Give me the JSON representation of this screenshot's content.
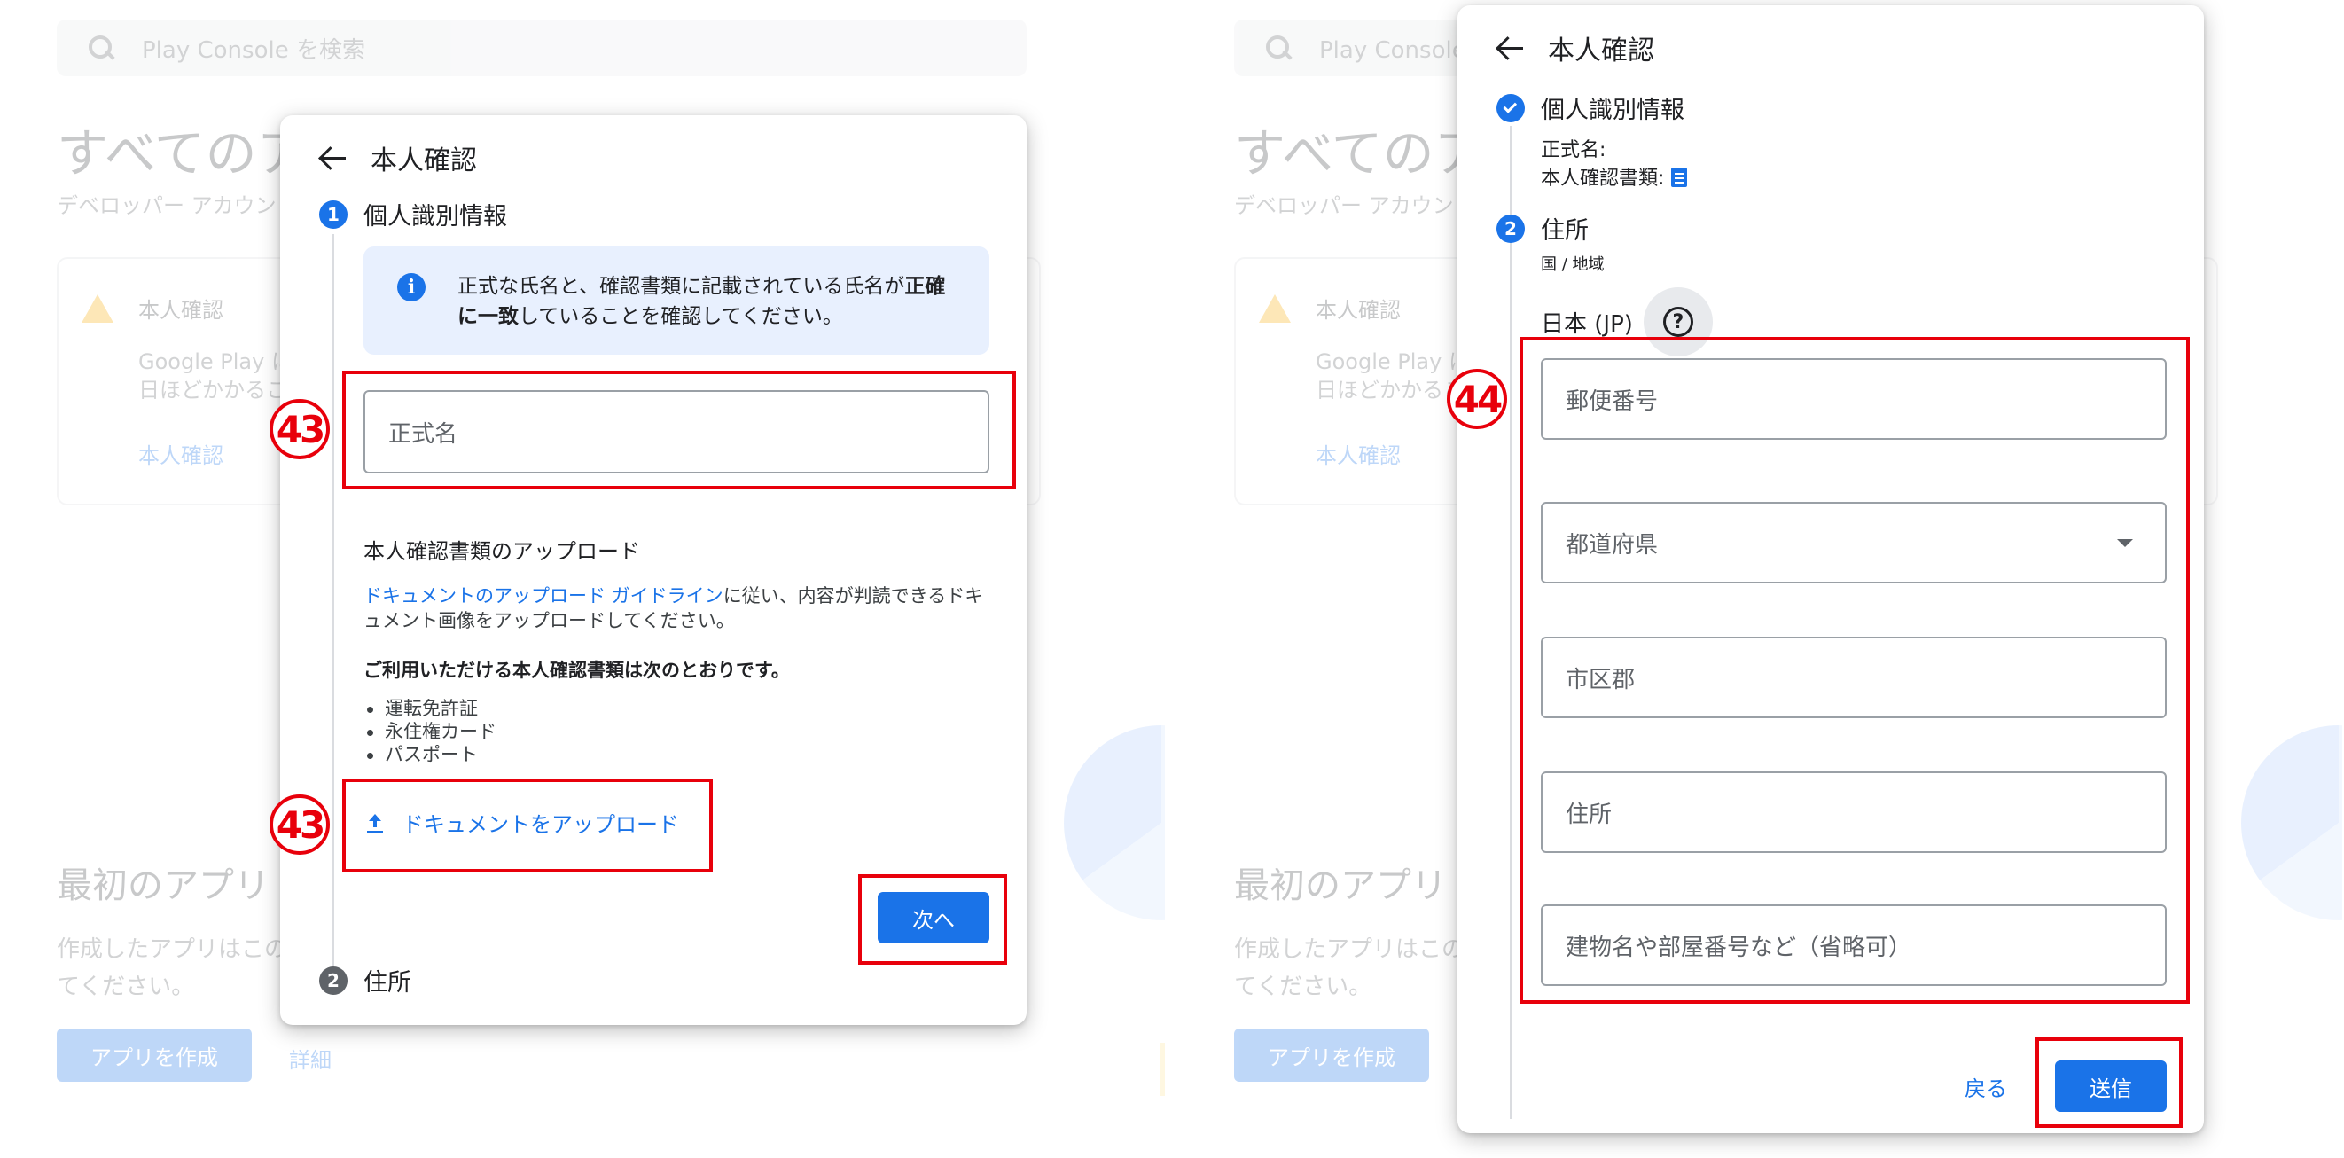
{
  "background": {
    "search_placeholder": "Play Console を検索",
    "heading_all_apps": "すべてのア",
    "heading_all_apps_right": "すべてのア",
    "developer_account_text": "デベロッパー アカウント",
    "warning_title": "本人確認",
    "warning_body_line1": "Google Play に",
    "warning_body_line2": "日ほどかかるこ",
    "warning_link": "本人確認",
    "first_app_heading": "最初のアプリ",
    "first_app_body_line1": "作成したアプリはこの",
    "first_app_body_line2": "てください。",
    "create_app_button": "アプリを作成",
    "details_link": "詳細"
  },
  "left_dialog": {
    "title": "本人確認",
    "step1_number": "1",
    "step1_label": "個人識別情報",
    "info_text_before": "正式な氏名と、確認書類に記載されている氏名が",
    "info_text_bold": "正確に一致",
    "info_text_after": "していることを確認してください。",
    "legal_name_placeholder": "正式名",
    "upload_section_title": "本人確認書類のアップロード",
    "guideline_link": "ドキュメントのアップロード ガイドライン",
    "guideline_text": "に従い、内容が判読できるドキュメント画像をアップロードしてください。",
    "accepted_docs_title": "ご利用いただける本人確認書類は次のとおりです。",
    "accepted_docs": [
      "運転免許証",
      "永住権カード",
      "パスポート"
    ],
    "upload_button": "ドキュメントをアップロード",
    "next_button": "次へ",
    "step2_number": "2",
    "step2_label": "住所",
    "marker_1": "43",
    "marker_2": "43"
  },
  "right_dialog": {
    "title": "本人確認",
    "step1_label": "個人識別情報",
    "legal_name_label": "正式名:",
    "id_doc_label": "本人確認書類:",
    "step2_number": "2",
    "step2_label": "住所",
    "country_label": "国 / 地域",
    "country_value": "日本 (JP)",
    "fields": {
      "postal_code": "郵便番号",
      "prefecture": "都道府県",
      "city": "市区郡",
      "address": "住所",
      "building": "建物名や部屋番号など（省略可）"
    },
    "back_button": "戻る",
    "submit_button": "送信",
    "marker": "44"
  },
  "colors": {
    "accent": "#1a73e8",
    "annotation_red": "#e8000b",
    "info_bg": "#e8f0fe"
  }
}
